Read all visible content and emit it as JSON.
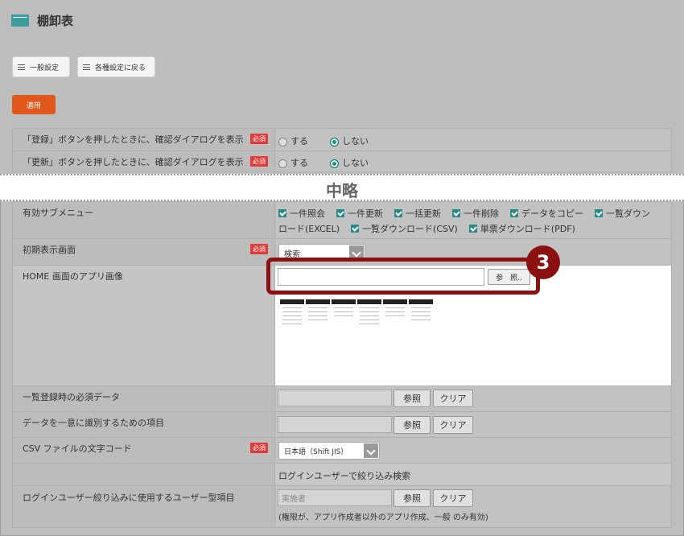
{
  "app": {
    "title": "棚卸表"
  },
  "toolbar": {
    "general_settings": "一般設定",
    "back_to_settings": "各種設定に戻る",
    "apply": "適用"
  },
  "rows_top": [
    {
      "label": "「登録」ボタンを押したときに、確認ダイアログを表示",
      "required": "必須",
      "opt_yes": "する",
      "opt_no": "しない"
    },
    {
      "label": "「更新」ボタンを押したときに、確認ダイアログを表示",
      "required": "必須",
      "opt_yes": "する",
      "opt_no": "しない"
    }
  ],
  "omitted": "中略",
  "submenu": {
    "label": "有効サブメニュー",
    "items": [
      "一件照会",
      "一件更新",
      "一括更新",
      "一件削除",
      "データをコピー",
      "一覧ダウンロード(EXCEL)",
      "一覧ダウンロード(CSV)",
      "単票ダウンロード(PDF)"
    ]
  },
  "initial_screen": {
    "label": "初期表示画面",
    "required": "必須",
    "value": "検索"
  },
  "home_image": {
    "label": "HOME 画面のアプリ画像",
    "browse": "参　照.."
  },
  "required_data": {
    "label": "一覧登録時の必須データ",
    "ref": "参照",
    "clear": "クリア"
  },
  "unique_item": {
    "label": "データを一意に識別するための項目",
    "ref": "参照",
    "clear": "クリア"
  },
  "csv_encoding": {
    "label": "CSV ファイルの文字コード",
    "required": "必須",
    "value": "日本語（Shift JIS）"
  },
  "section_login_filter": "ログインユーザーで絞り込み検索",
  "login_filter_item": {
    "label": "ログインユーザー絞り込みに使用するユーザー型項目",
    "placeholder": "実施者",
    "ref": "参照",
    "clear": "クリア",
    "note": "(権限が、アプリ作成者以外のアプリ作成、一般 のみ有効)"
  },
  "callout_number": "3",
  "colors": {
    "accent": "#3a9c9c",
    "apply": "#e1561b",
    "required": "#e03a3a",
    "callout": "#8b1010"
  }
}
